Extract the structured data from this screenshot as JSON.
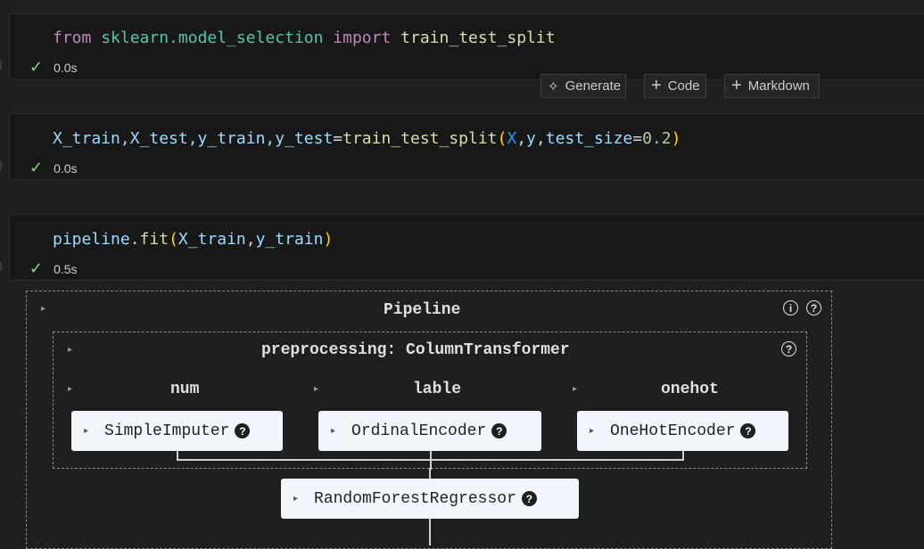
{
  "cells": [
    {
      "time": "0.0s"
    },
    {
      "time": "0.0s"
    },
    {
      "time": "0.5s"
    }
  ],
  "code": {
    "line1": {
      "from": "from",
      "module": "sklearn.model_selection",
      "import": "import",
      "name": "train_test_split"
    },
    "line2": {
      "lhs": "X_train,X_test,y_train,y_test",
      "eq": "=",
      "fn": "train_test_split",
      "open": "(",
      "a1": "X",
      "c1": ",",
      "a2": "y",
      "c2": ",",
      "kw": "test_size",
      "eq2": "=",
      "val": "0.2",
      "close": ")"
    },
    "line3": {
      "obj": "pipeline",
      "dot": ".",
      "fn": "fit",
      "open": "(",
      "a1": "X_train",
      "c": ",",
      "a2": "y_train",
      "close": ")"
    }
  },
  "toolbar": {
    "generate": "Generate",
    "code": "Code",
    "markdown": "Markdown"
  },
  "icons": {
    "check": "✓",
    "sparkle": "✧",
    "plus": "+",
    "expand": "▸",
    "info": "i",
    "help": "?"
  },
  "diagram": {
    "pipeline_title": "Pipeline",
    "preprocessing_title": "preprocessing: ColumnTransformer",
    "branches": [
      {
        "label": "num",
        "estimator": "SimpleImputer"
      },
      {
        "label": "lable",
        "estimator": "OrdinalEncoder"
      },
      {
        "label": "onehot",
        "estimator": "OneHotEncoder"
      }
    ],
    "final_estimator": "RandomForestRegressor"
  }
}
